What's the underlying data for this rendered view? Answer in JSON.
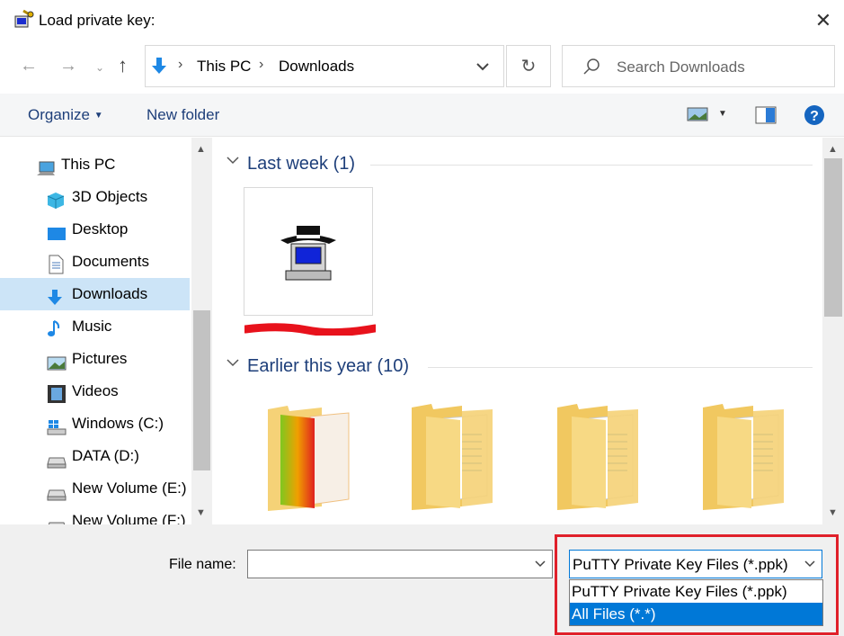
{
  "window": {
    "title": "Load private key:"
  },
  "address": {
    "segments": [
      "This PC",
      "Downloads"
    ]
  },
  "search": {
    "placeholder": "Search Downloads"
  },
  "toolbar": {
    "organize_label": "Organize",
    "new_folder_label": "New folder"
  },
  "sidebar": {
    "items": [
      {
        "label": "This PC",
        "icon": "computer-icon"
      },
      {
        "label": "3D Objects",
        "icon": "cube-icon"
      },
      {
        "label": "Desktop",
        "icon": "desktop-icon"
      },
      {
        "label": "Documents",
        "icon": "document-icon"
      },
      {
        "label": "Downloads",
        "icon": "download-arrow-icon",
        "selected": true
      },
      {
        "label": "Music",
        "icon": "music-note-icon"
      },
      {
        "label": "Pictures",
        "icon": "pictures-icon"
      },
      {
        "label": "Videos",
        "icon": "film-icon"
      },
      {
        "label": "Windows (C:)",
        "icon": "windows-drive-icon"
      },
      {
        "label": "DATA (D:)",
        "icon": "drive-icon"
      },
      {
        "label": "New Volume (E:)",
        "icon": "drive-icon"
      },
      {
        "label": "New Volume (F:)",
        "icon": "drive-icon"
      }
    ]
  },
  "content": {
    "groups": [
      {
        "label": "Last week (1)",
        "items": [
          {
            "icon": "putty-app-icon",
            "name_redacted": true
          }
        ]
      },
      {
        "label": "Earlier this year (10)",
        "items": [
          {
            "icon": "folder-colorful-icon"
          },
          {
            "icon": "folder-icon"
          },
          {
            "icon": "folder-icon"
          },
          {
            "icon": "folder-icon"
          }
        ]
      }
    ]
  },
  "footer": {
    "filename_label": "File name:",
    "filename_value": "",
    "filetype_selected": "PuTTY Private Key Files (*.ppk)",
    "filetype_options": [
      "PuTTY Private Key Files (*.ppk)",
      "All Files (*.*)"
    ],
    "highlighted_option_index": 1
  },
  "colors": {
    "accent": "#0078d7",
    "highlight": "#e0202a",
    "link": "#1e3f7a"
  }
}
